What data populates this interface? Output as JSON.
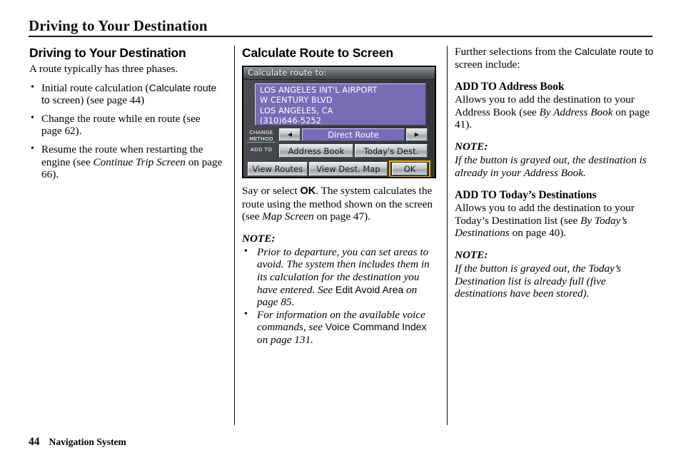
{
  "page": {
    "title": "Driving to Your Destination",
    "footer_page_number": "44",
    "footer_label": "Navigation System"
  },
  "column1": {
    "heading": "Driving to Your Destination",
    "intro": "A route typically has three phases.",
    "bullets": [
      {
        "pre": "Initial route calculation (",
        "screen": "Calculate route to",
        "post": " screen) (see page 44)"
      },
      {
        "text": "Change the route while en route (see page 62)."
      },
      {
        "pre": "Resume the route when restarting the engine (see ",
        "italic": "Continue Trip Screen",
        "post": " on page 66)."
      }
    ]
  },
  "column2": {
    "heading": "Calculate Route to Screen",
    "navscreen": {
      "title": "Calculate route to:",
      "address_lines": [
        "LOS ANGELES INT'L AIRPORT",
        "W CENTURY BLVD",
        "LOS ANGELES, CA",
        "(310)646-5252"
      ],
      "change_method_label": "CHANGE METHOD",
      "add_to_label": "ADD TO",
      "prev_icon": "triangle-left-icon",
      "next_icon": "triangle-right-icon",
      "method_value": "Direct Route",
      "address_book_button": "Address Book",
      "todays_dest_button": "Today's Dest.",
      "view_routes_button": "View Routes",
      "view_dest_map_button": "View Dest. Map",
      "ok_button": "OK",
      "highlight_color": "#f0b400",
      "panel_color": "#7a6bb7"
    },
    "para1": {
      "pre": "Say or select ",
      "bold": "OK",
      "mid": ". The system calculates the route using the method shown on the screen (see ",
      "italic": "Map Screen",
      "post": " on page 47)."
    },
    "note_heading": "NOTE:",
    "note_bullets": [
      {
        "italic1": "Prior to departure, you can set areas to avoid. The system then includes them in its calculation for the destination you have entered. See ",
        "screen": "Edit Avoid Area",
        "italic2": " on page 85."
      },
      {
        "italic1": "For information on the available voice commands, see ",
        "screen": "Voice Command Index",
        "italic2": " on page 131."
      }
    ]
  },
  "column3": {
    "intro": {
      "pre": "Further selections from the ",
      "screen": "Calculate route to",
      "post": " screen include:"
    },
    "sections": [
      {
        "heading": "ADD TO Address Book",
        "body_pre": "Allows you to add the destination to your Address Book (see ",
        "body_italic": "By Address Book",
        "body_post": " on page 41).",
        "note_heading": "NOTE:",
        "note_text": "If the button is grayed out, the destination is already in your Address Book."
      },
      {
        "heading": "ADD TO Today’s Destinations",
        "body_pre": "Allows you to add the destination to your Today’s Destination list (see ",
        "body_italic": "By Today’s Destinations",
        "body_post": " on page 40).",
        "note_heading": "NOTE:",
        "note_text": "If the button is grayed out, the Today’s Destination list is already full (five destinations have been stored)."
      }
    ]
  }
}
